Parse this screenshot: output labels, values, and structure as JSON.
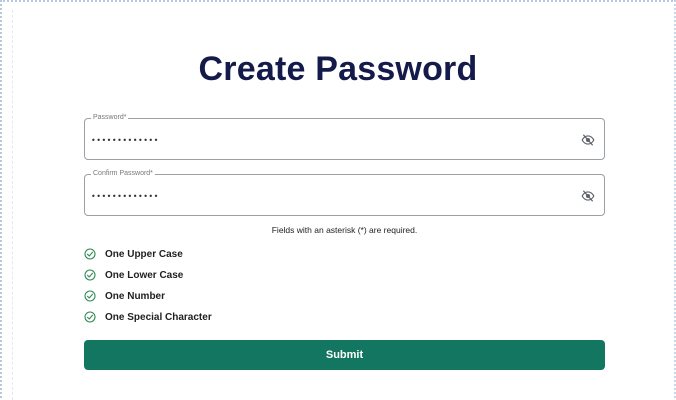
{
  "title": "Create Password",
  "password_field": {
    "label": "Password*",
    "value": "•••••••••••••"
  },
  "confirm_field": {
    "label": "Confirm Password*",
    "value": "•••••••••••••"
  },
  "required_hint": "Fields with an asterisk (*) are required.",
  "rules": [
    "One Upper Case",
    "One Lower Case",
    "One Number",
    "One Special Character"
  ],
  "submit_label": "Submit",
  "colors": {
    "title": "#141a4a",
    "accent": "#137660",
    "check": "#2e8b57"
  },
  "icons": {
    "visibility_toggle": "eye-off-icon",
    "rule_status": "check-circle-icon"
  }
}
